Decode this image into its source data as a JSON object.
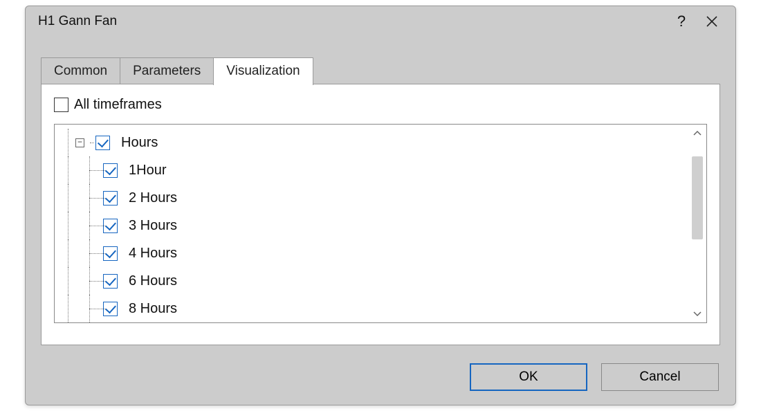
{
  "title": "H1 Gann Fan",
  "tabs": [
    {
      "label": "Common",
      "active": false
    },
    {
      "label": "Parameters",
      "active": false
    },
    {
      "label": "Visualization",
      "active": true
    }
  ],
  "all_timeframes": {
    "label": "All timeframes",
    "checked": false
  },
  "tree": {
    "group": {
      "label": "Hours",
      "checked": true,
      "expanded": true
    },
    "items": [
      {
        "label": "1Hour",
        "checked": true
      },
      {
        "label": "2 Hours",
        "checked": true
      },
      {
        "label": "3 Hours",
        "checked": true
      },
      {
        "label": "4 Hours",
        "checked": true
      },
      {
        "label": "6 Hours",
        "checked": true
      },
      {
        "label": "8 Hours",
        "checked": true
      }
    ]
  },
  "buttons": {
    "ok": "OK",
    "cancel": "Cancel"
  }
}
